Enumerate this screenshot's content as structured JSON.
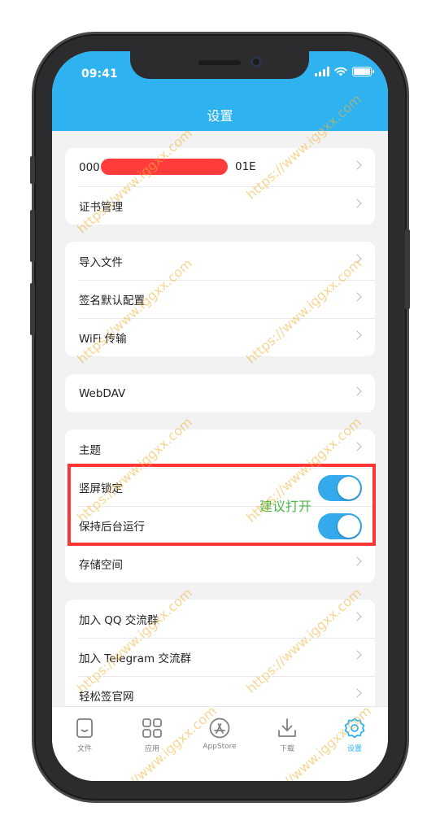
{
  "status_bar": {
    "time": "09:41"
  },
  "header": {
    "title": "设置"
  },
  "groups": {
    "account": {
      "device_id_prefix": "000",
      "device_id_suffix": "01E",
      "certificate": "证书管理"
    },
    "files": {
      "import": "导入文件",
      "signing": "签名默认配置",
      "wifi": "WiFi 传输"
    },
    "webdav": {
      "label": "WebDAV"
    },
    "display": {
      "theme": "主题",
      "portrait_lock": "竖屏锁定",
      "background_run": "保持后台运行",
      "storage": "存储空间"
    },
    "community": {
      "qq": "加入 QQ 交流群",
      "telegram": "加入 Telegram 交流群",
      "website": "轻松签官网"
    }
  },
  "annotation": {
    "hint": "建议打开",
    "highlight_color": "#ff3434"
  },
  "toggles": {
    "portrait_lock": true,
    "background_run": true
  },
  "tabbar": {
    "items": [
      {
        "label": "文件",
        "icon": "file-icon",
        "active": false
      },
      {
        "label": "应用",
        "icon": "grid-icon",
        "active": false
      },
      {
        "label": "AppStore",
        "icon": "appstore-icon",
        "active": false
      },
      {
        "label": "下载",
        "icon": "download-icon",
        "active": false
      },
      {
        "label": "设置",
        "icon": "gear-icon",
        "active": true
      }
    ]
  },
  "watermark": {
    "text": "https://www.iggxx.com"
  },
  "colors": {
    "accent": "#2fb2f0",
    "toggle_on": "#34aaec",
    "hint": "#4cb84c"
  }
}
